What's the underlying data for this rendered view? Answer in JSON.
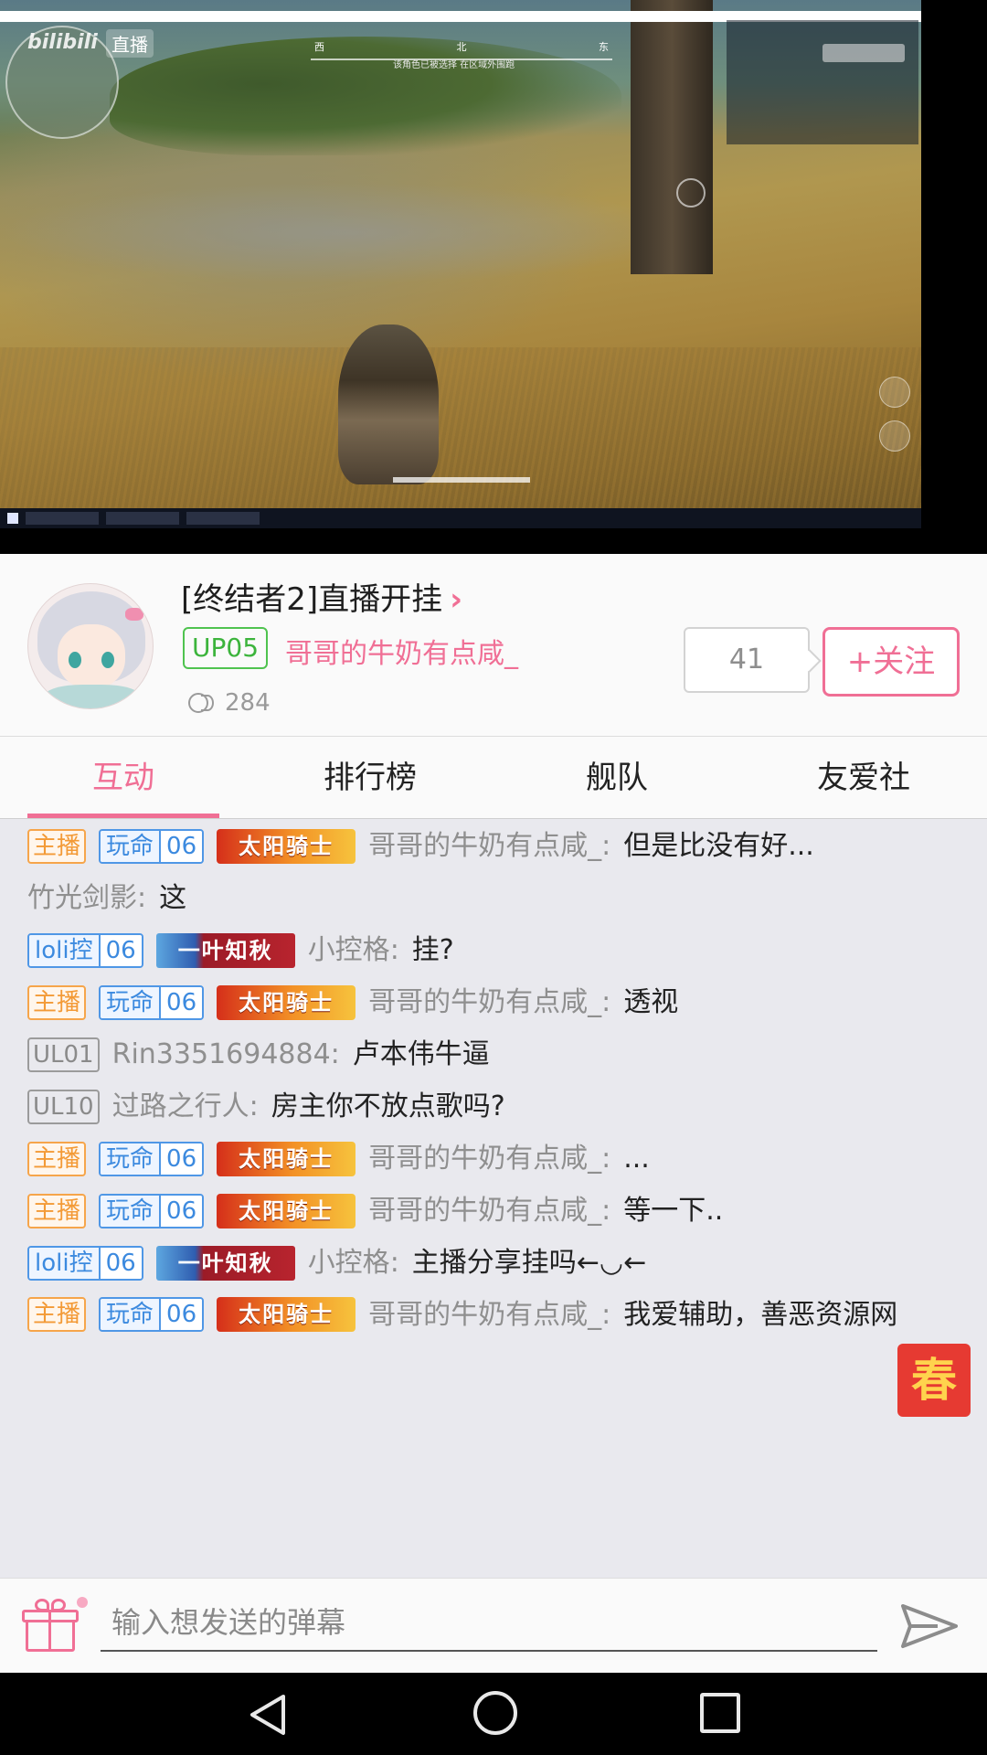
{
  "video": {
    "watermark": "bilibili",
    "live_badge": "直播",
    "compass": [
      "西",
      "北",
      "东"
    ],
    "game_hint": "该角色已被选择 在区域外围跑"
  },
  "streamer": {
    "room_title": "[终结者2]直播开挂",
    "up_badge": "UP05",
    "name": "哥哥的牛奶有点咸_",
    "viewer_count": "284",
    "fans_count": "41",
    "follow_label": "+关注"
  },
  "tabs": [
    {
      "label": "互动",
      "active": true
    },
    {
      "label": "排行榜",
      "active": false
    },
    {
      "label": "舰队",
      "active": false
    },
    {
      "label": "友爱社",
      "active": false
    }
  ],
  "chat": [
    {
      "host": "主播",
      "medal_name": "玩命",
      "medal_level": "06",
      "title": "太阳骑士",
      "user": "哥哥的牛奶有点咸_",
      "text": "但是比没有好..."
    },
    {
      "user": "竹光剑影",
      "text": "这"
    },
    {
      "medal_name": "loli控",
      "medal_level": "06",
      "title": "一叶知秋",
      "user": "小控格",
      "text": "挂?"
    },
    {
      "host": "主播",
      "medal_name": "玩命",
      "medal_level": "06",
      "title": "太阳骑士",
      "user": "哥哥的牛奶有点咸_",
      "text": "透视"
    },
    {
      "ul": "UL01",
      "user": "Rin3351694884",
      "text": "卢本伟牛逼"
    },
    {
      "ul": "UL10",
      "user": "过路之行人",
      "text": "房主你不放点歌吗?"
    },
    {
      "host": "主播",
      "medal_name": "玩命",
      "medal_level": "06",
      "title": "太阳骑士",
      "user": "哥哥的牛奶有点咸_",
      "text": "..."
    },
    {
      "host": "主播",
      "medal_name": "玩命",
      "medal_level": "06",
      "title": "太阳骑士",
      "user": "哥哥的牛奶有点咸_",
      "text": "等一下.."
    },
    {
      "medal_name": "loli控",
      "medal_level": "06",
      "title": "一叶知秋",
      "user": "小控格",
      "text": "主播分享挂吗←◡←"
    },
    {
      "host": "主播",
      "medal_name": "玩命",
      "medal_level": "06",
      "title": "太阳骑士",
      "user": "哥哥的牛奶有点咸_",
      "text": "我爱辅助，善恶资源网"
    }
  ],
  "spring_badge": "春",
  "input": {
    "placeholder": "输入想发送的弹幕"
  },
  "colors": {
    "accent": "#f06f95",
    "up_badge": "#3cb43c",
    "host_badge": "#f39a36",
    "medal": "#3c8adf"
  }
}
